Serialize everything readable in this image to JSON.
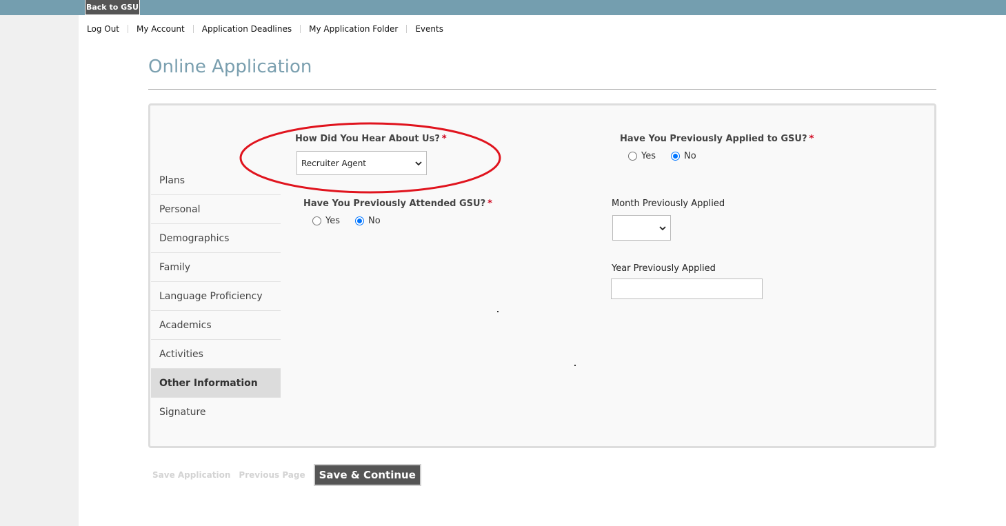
{
  "header": {
    "back_label": "Back to GSU"
  },
  "nav": {
    "items": [
      "Log Out",
      "My Account",
      "Application Deadlines",
      "My Application Folder",
      "Events"
    ]
  },
  "page": {
    "title": "Online Application"
  },
  "sidebar": {
    "items": [
      "Plans",
      "Personal",
      "Demographics",
      "Family",
      "Language Proficiency",
      "Academics",
      "Activities",
      "Other Information",
      "Signature"
    ],
    "active": "Other Information"
  },
  "form": {
    "hear_about": {
      "label": "How Did You Hear About Us?",
      "required_mark": "*",
      "value": "Recruiter Agent"
    },
    "previously_attended": {
      "label": "Have You Previously Attended GSU?",
      "required_mark": "*",
      "options": [
        "Yes",
        "No"
      ],
      "selected": "No"
    },
    "previously_applied": {
      "label": "Have You Previously Applied to GSU?",
      "required_mark": "*",
      "options": [
        "Yes",
        "No"
      ],
      "selected": "No"
    },
    "month_applied": {
      "label": "Month Previously Applied",
      "value": ""
    },
    "year_applied": {
      "label": "Year Previously Applied",
      "value": ""
    }
  },
  "footer": {
    "save_label": "Save Application",
    "previous_label": "Previous Page",
    "continue_label": "Save & Continue"
  },
  "icons": {
    "select_chevron": "chevron-down-icon"
  },
  "colors": {
    "topbar": "#749eaf",
    "title": "#7a9faf",
    "required": "#d0021b",
    "radio_selected": "#0075ff",
    "highlight": "#e0141e",
    "button": "#555555"
  }
}
